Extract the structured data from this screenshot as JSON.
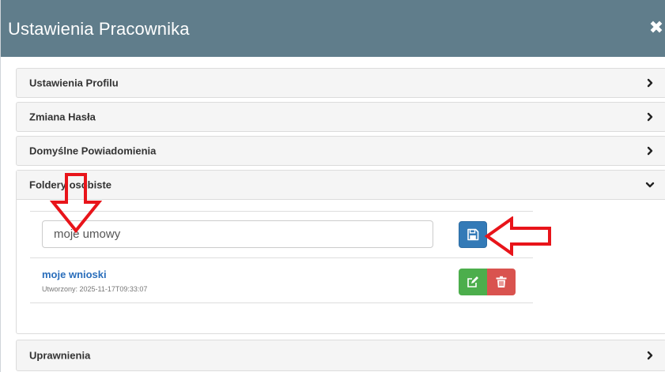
{
  "modal": {
    "title": "Ustawienia Pracownika",
    "close_glyph": "✖"
  },
  "panels": [
    {
      "label": "Ustawienia Profilu",
      "state": "collapsed",
      "icon": "chevron-right-icon"
    },
    {
      "label": "Zmiana Hasła",
      "state": "collapsed",
      "icon": "chevron-right-icon"
    },
    {
      "label": "Domyślne Powiadomienia",
      "state": "collapsed",
      "icon": "chevron-right-icon"
    },
    {
      "label": "Foldery osobiste",
      "state": "expanded",
      "icon": "chevron-down-icon"
    },
    {
      "label": "Uprawnienia",
      "state": "collapsed",
      "icon": "chevron-right-icon"
    }
  ],
  "folders": {
    "new_folder_value": "moje umowy",
    "save_icon": "floppy-disk-icon",
    "items": [
      {
        "name": "moje wnioski",
        "created": "Utworzony: 2025-11-17T09:33:07",
        "edit_icon": "edit-icon",
        "delete_icon": "trash-icon"
      }
    ]
  },
  "colors": {
    "header": "#607d8b",
    "primary": "#337ab7",
    "success": "#4cae4c",
    "danger": "#d9534f",
    "annotation": "#e8141a"
  }
}
